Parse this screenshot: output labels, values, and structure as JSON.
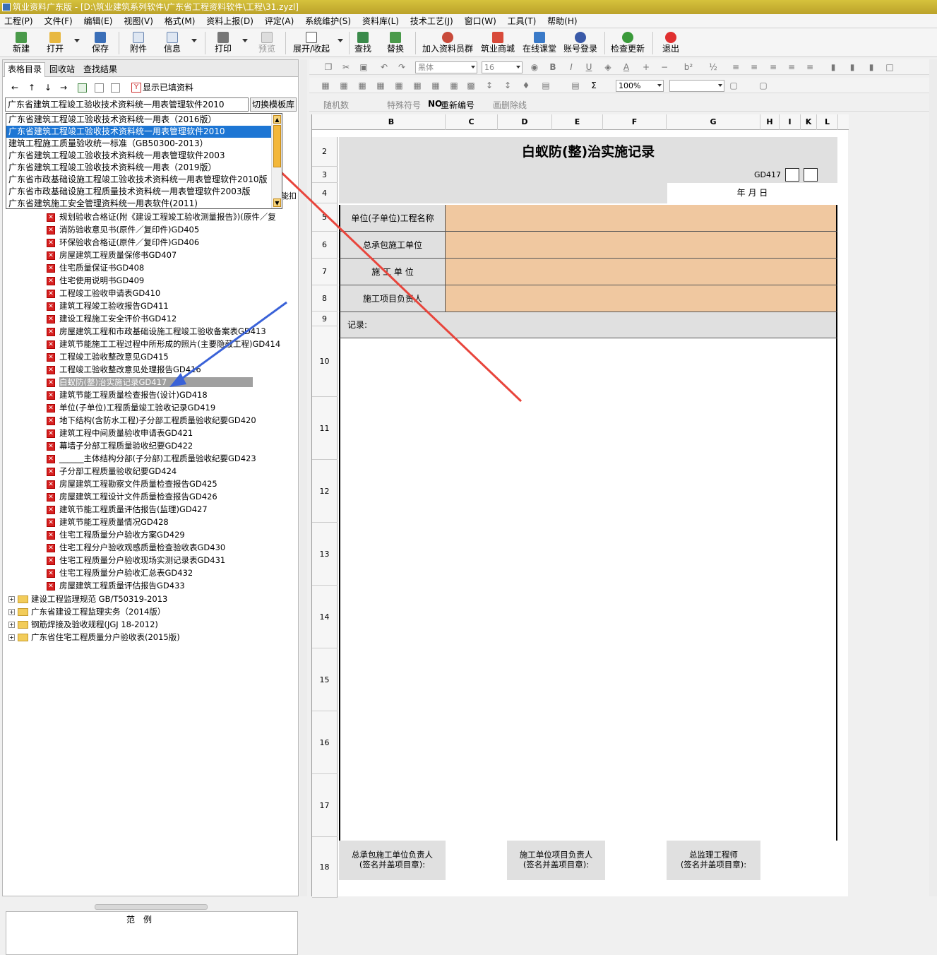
{
  "window": {
    "title": "筑业资料广东版 - [D:\\筑业建筑系列软件\\广东省工程资料软件\\工程\\31.zyzl]"
  },
  "menu": [
    "工程(P)",
    "文件(F)",
    "编辑(E)",
    "视图(V)",
    "格式(M)",
    "资料上报(D)",
    "评定(A)",
    "系统维护(S)",
    "资料库(L)",
    "技术工艺(J)",
    "窗口(W)",
    "工具(T)",
    "帮助(H)"
  ],
  "toolbar": {
    "new": "新建",
    "open": "打开",
    "save": "保存",
    "attach": "附件",
    "info": "信息",
    "print": "打印",
    "preview": "预览",
    "expand": "展开/收起",
    "find": "查找",
    "replace": "替换",
    "join_group": "加入资料员群",
    "mall": "筑业商城",
    "classroom": "在线课堂",
    "login": "账号登录",
    "update": "检查更新",
    "exit": "退出"
  },
  "left": {
    "tabs": [
      "表格目录",
      "回收站",
      "查找结果"
    ],
    "show_filled": "显示已填资料",
    "combo_value": "广东省建筑工程竣工验收技术资料统一用表管理软件2010",
    "switch_label": "切换模板库",
    "dropdown": [
      "广东省建筑工程竣工验收技术资料统一用表（2016版）",
      "广东省建筑工程竣工验收技术资料统一用表管理软件2010",
      "建筑工程施工质量验收统一标准（GB50300-2013）",
      "广东省建筑工程竣工验收技术资料统一用表管理软件2003",
      "广东省建筑工程竣工验收技术资料统一用表（2019版）",
      "广东省市政基础设施工程竣工验收技术资料统一用表管理软件2010版",
      "广东省市政基础设施工程质量技术资料统一用表管理软件2003版",
      "广东省建筑施工安全管理资料统一用表软件(2011)"
    ],
    "hidden_text": "能扣",
    "tree_items": [
      "规划验收合格证(附《建设工程竣工验收测量报告》)(原件／复",
      "消防验收意见书(原件／复印件)GD405",
      "环保验收合格证(原件／复印件)GD406",
      "房屋建筑工程质量保修书GD407",
      "住宅质量保证书GD408",
      "住宅使用说明书GD409",
      "工程竣工验收申请表GD410",
      "建筑工程竣工验收报告GD411",
      "建设工程施工安全评价书GD412",
      "房屋建筑工程和市政基础设施工程竣工验收备案表GD413",
      "建筑节能施工工程过程中所形成的照片(主要隐蔽工程)GD414",
      "工程竣工验收整改意见GD415",
      "工程竣工验收整改意见处理报告GD416",
      "白蚁防(整)治实施记录GD417",
      "建筑节能工程质量检查报告(设计)GD418",
      "单位(子单位)工程质量竣工验收记录GD419",
      "地下结构(含防水工程)子分部工程质量验收纪要GD420",
      "建筑工程中间质量验收申请表GD421",
      "幕墙子分部工程质量验收纪要GD422",
      "______主体结构分部(子分部)工程质量验收纪要GD423",
      "子分部工程质量验收纪要GD424",
      "房屋建筑工程勘察文件质量检查报告GD425",
      "房屋建筑工程设计文件质量检查报告GD426",
      "建筑节能工程质量评估报告(监理)GD427",
      "建筑节能工程质量情况GD428",
      "住宅工程质量分户验收方案GD429",
      "住宅工程分户验收观感质量检查验收表GD430",
      "住宅工程质量分户验收现场实测记录表GD431",
      "住宅工程质量分户验收汇总表GD432",
      "房屋建筑工程质量评估报告GD433"
    ],
    "selected_index": 13,
    "folders": [
      "建设工程监理规范 GB/T50319-2013",
      "广东省建设工程监理实务（2014版）",
      "钢筋焊接及验收规程(JGJ 18-2012)",
      "广东省住宅工程质量分户验收表(2015版)"
    ],
    "legend": "范例"
  },
  "editor": {
    "font_name": "黑体",
    "font_size": "16",
    "zoom": "100%",
    "random": "随机数",
    "special": "特殊符号",
    "renumber": "重新编号",
    "delline": "画删除线",
    "cols": [
      "B",
      "C",
      "D",
      "E",
      "F",
      "G",
      "H",
      "I",
      "K",
      "L"
    ],
    "rows": [
      "2",
      "3",
      "4",
      "5",
      "6",
      "7",
      "8",
      "9",
      "10",
      "11",
      "12",
      "13",
      "14",
      "15",
      "16",
      "17",
      "18"
    ],
    "form": {
      "title": "白蚁防(整)治实施记录",
      "code": "GD417",
      "date": "年    月    日",
      "f1": "单位(子单位)工程名称",
      "f2": "总承包施工单位",
      "f3": "施  工  单  位",
      "f4": "施工项目负责人",
      "record": "记录:",
      "s1a": "总承包施工单位负责人",
      "s1b": "(签名并盖项目章):",
      "s2a": "施工单位项目负责人",
      "s2b": "(签名并盖项目章):",
      "s3a": "总监理工程师",
      "s3b": "(签名并盖项目章):"
    }
  },
  "colors": {
    "field_fill": "#f0c8a0",
    "header_gray": "#e0e0e0",
    "arrow_red": "#e8453c",
    "arrow_blue": "#3a62d8"
  }
}
